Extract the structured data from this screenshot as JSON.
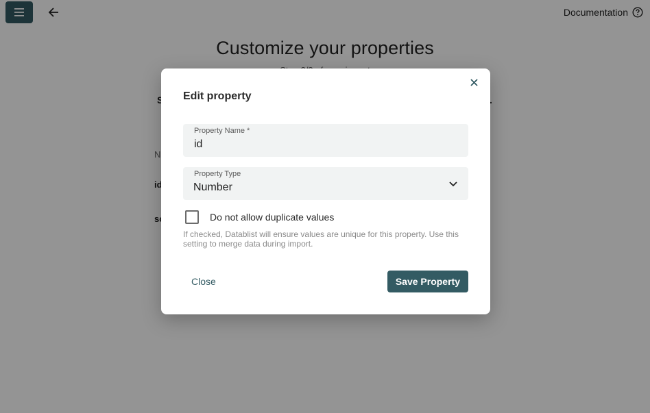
{
  "app": {
    "menu_icon": "hamburger-menu-icon",
    "back_icon": "arrow-left-icon",
    "documentation_label": "Documentation",
    "documentation_icon": "help-circle-icon"
  },
  "background": {
    "title": "Customize your properties",
    "subtitle": "Step 3/3 of your import",
    "step_left": "S",
    "step_right": ".",
    "column_header": "N",
    "rows": [
      "id",
      "sc"
    ]
  },
  "dialog": {
    "title": "Edit property",
    "close_icon": "close-icon",
    "name_field": {
      "label": "Property Name *",
      "value": "id"
    },
    "type_field": {
      "label": "Property Type",
      "value": "Number",
      "icon": "chevron-down-icon"
    },
    "duplicate_checkbox": {
      "label": "Do not allow duplicate values",
      "checked": false
    },
    "helper_text": "If checked, Datablist will ensure values are unique for this property. Use this setting to merge data during import.",
    "close_button": "Close",
    "save_button": "Save Property"
  },
  "colors": {
    "primary": "#335b63",
    "field_bg": "#f1f3f3",
    "backdrop": "rgba(0,0,0,0.42)"
  }
}
